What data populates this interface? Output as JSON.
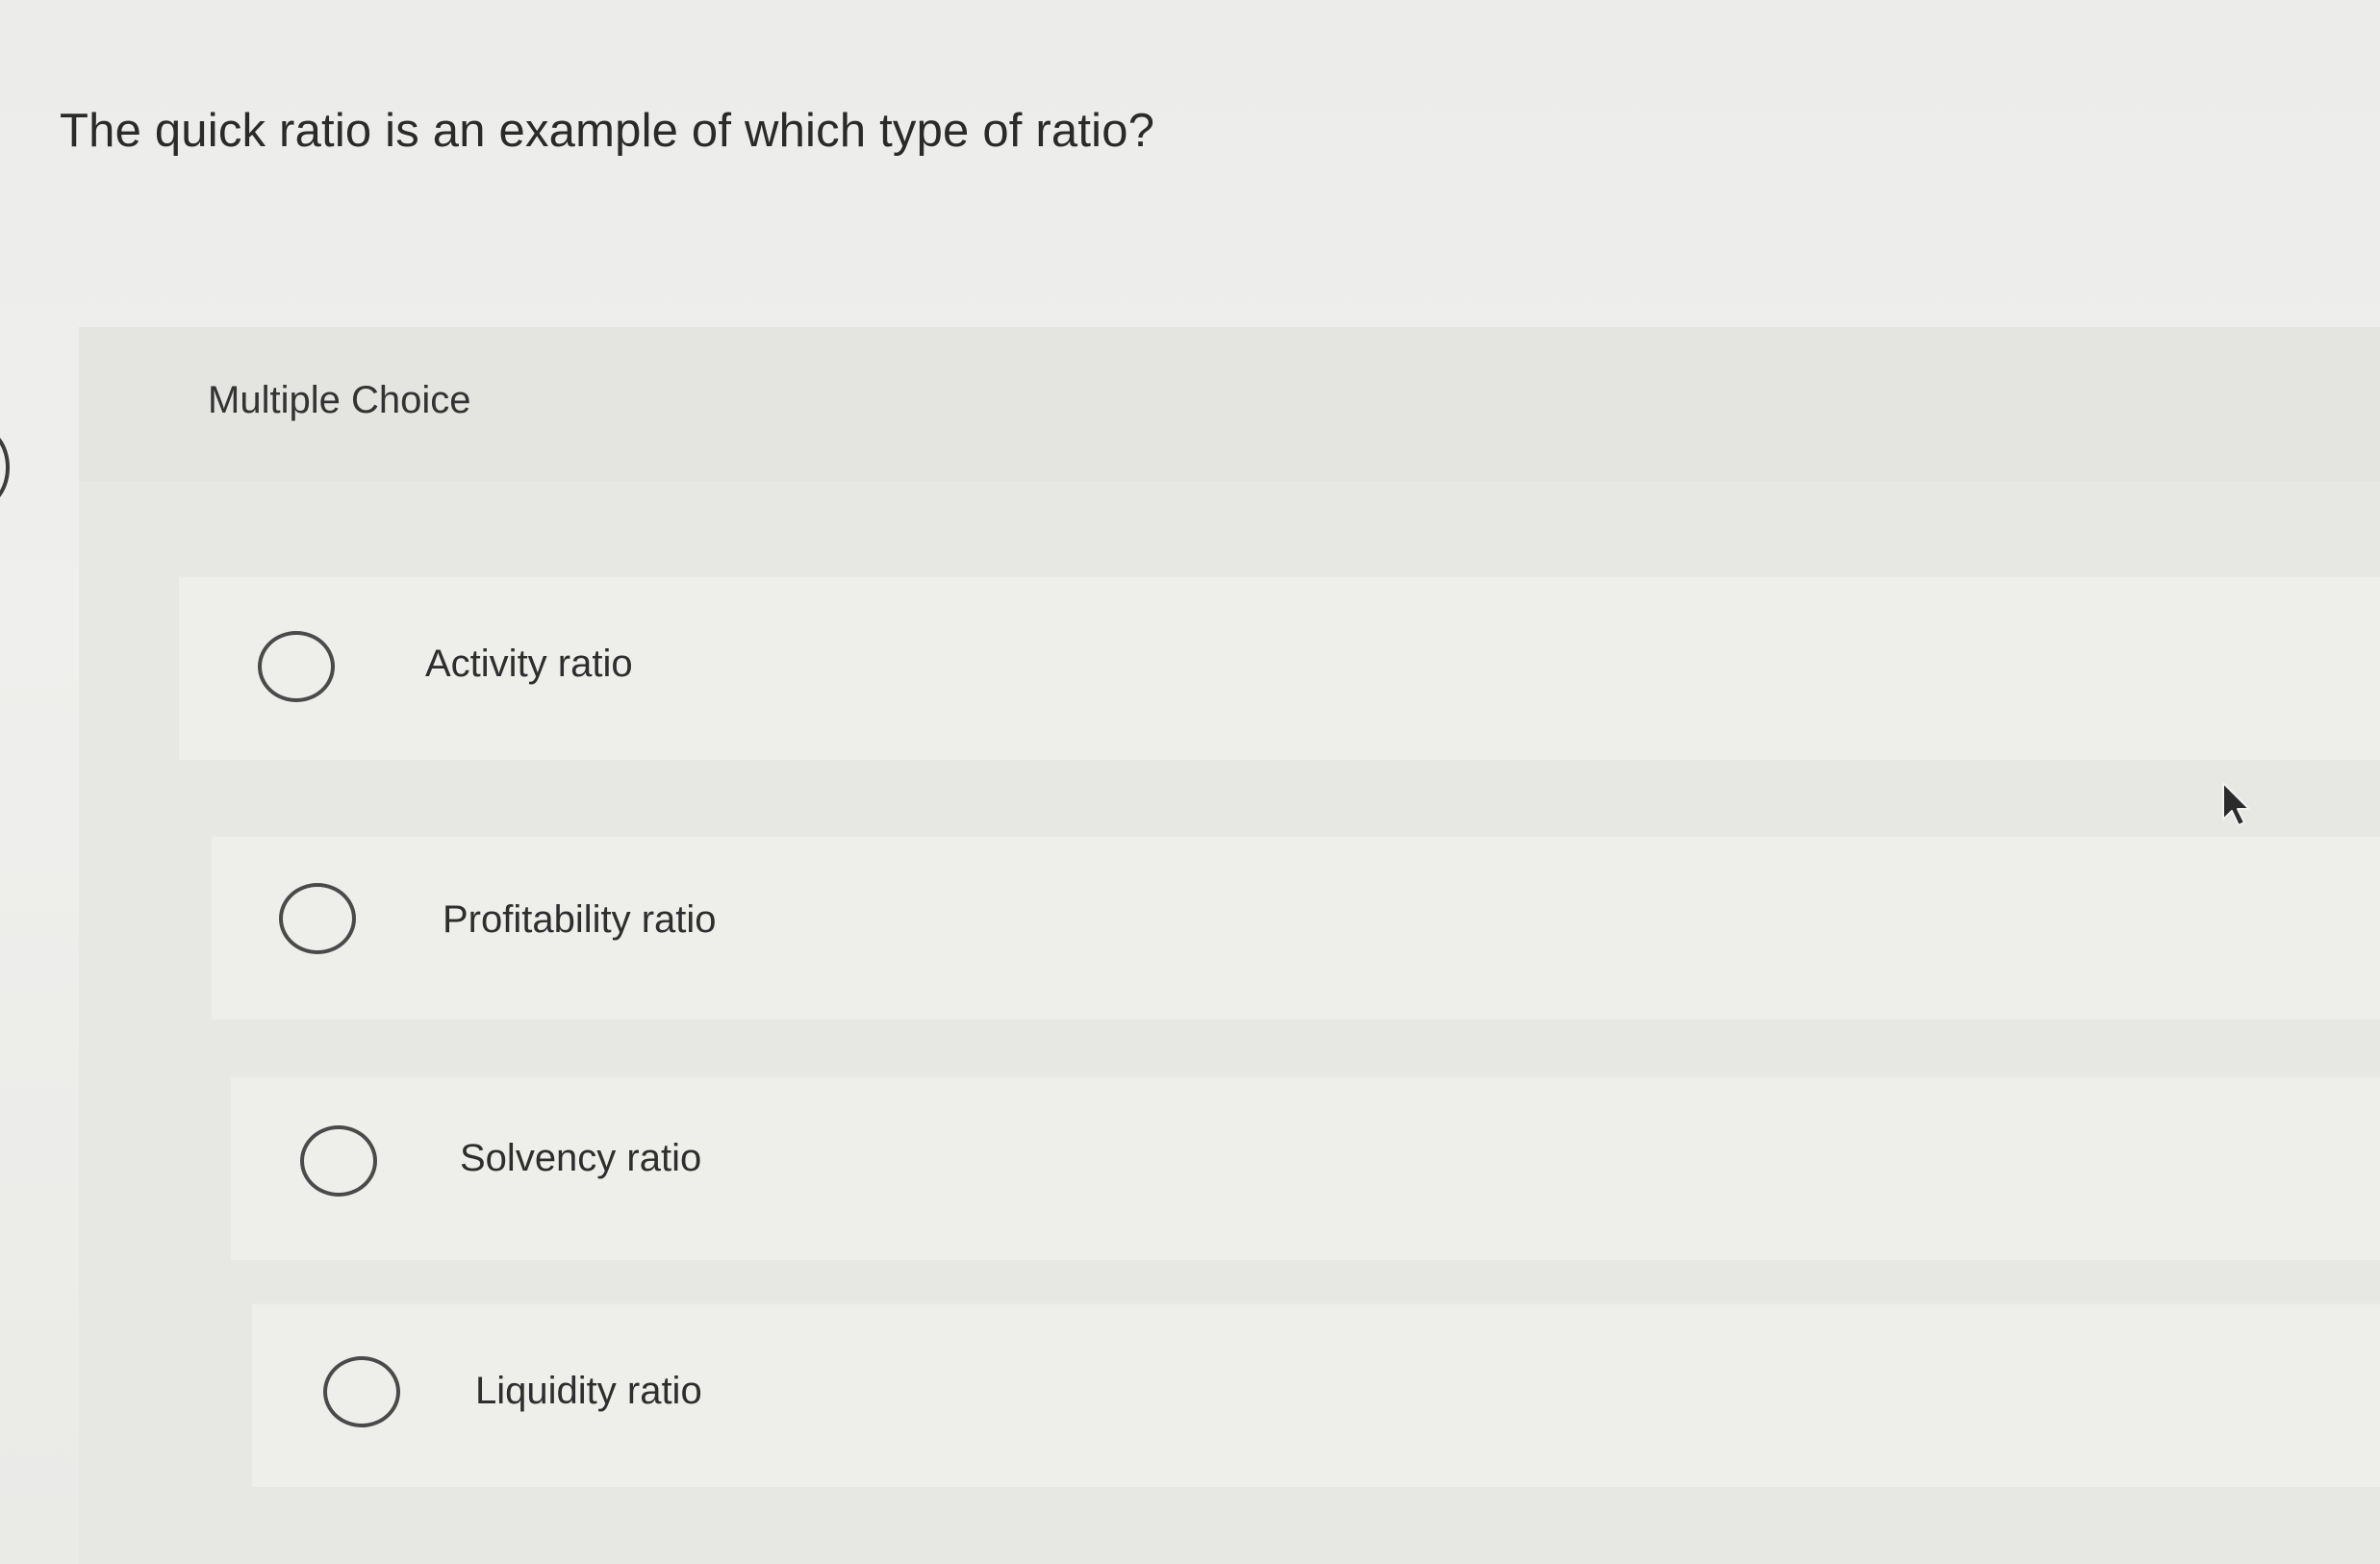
{
  "question": {
    "text": "The quick ratio is an example of which type of ratio?"
  },
  "multiple_choice": {
    "title": "Multiple Choice",
    "options": [
      {
        "label": "Activity ratio",
        "selected": false
      },
      {
        "label": "Profitability ratio",
        "selected": false
      },
      {
        "label": "Solvency ratio",
        "selected": false
      },
      {
        "label": "Liquidity ratio",
        "selected": false
      }
    ]
  },
  "icons": {
    "radio": "radio-button-empty-icon",
    "cursor": "mouse-pointer-icon"
  }
}
